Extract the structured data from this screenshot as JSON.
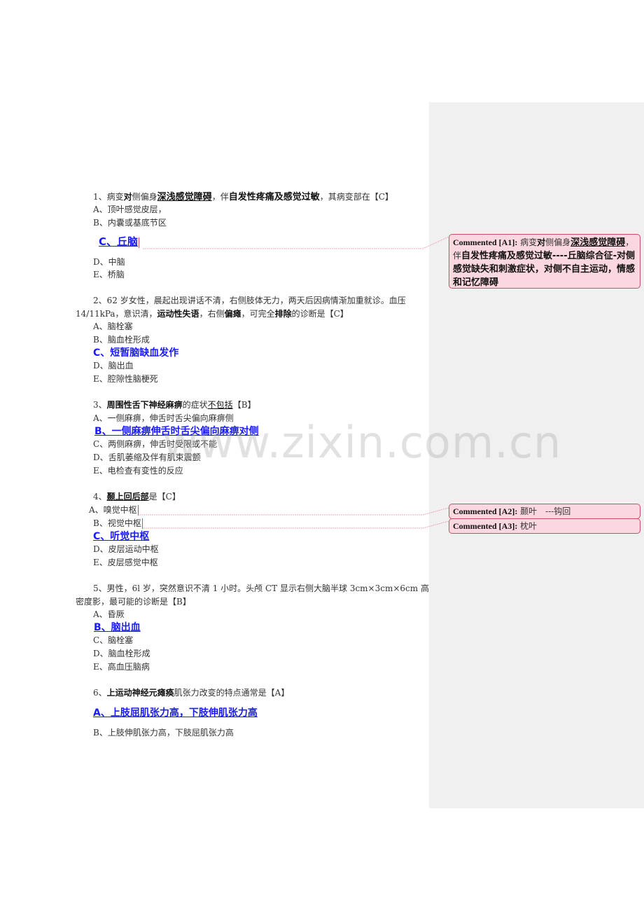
{
  "watermark": "www.zixin.com.cn",
  "questions": [
    {
      "stem_parts": [
        {
          "t": "1、病变",
          "s": "n"
        },
        {
          "t": "对",
          "s": "b"
        },
        {
          "t": "侧偏身",
          "s": "n"
        },
        {
          "t": "深浅感觉障碍",
          "s": "bu"
        },
        {
          "t": "，伴",
          "s": "n"
        },
        {
          "t": "自发性疼痛及感觉过敏",
          "s": "b"
        },
        {
          "t": "，其病变部在【C】",
          "s": "n"
        }
      ],
      "options": [
        "A、顶叶感觉皮层，",
        "B、内囊或基底节区",
        "C、丘脑",
        "D、中脑",
        "E、桥脑"
      ],
      "answer": "C"
    },
    {
      "stem_line1": "2、62 岁女性，晨起出现讲话不清，右侧肢体无力，两天后因病情渐加重就诊。血压",
      "stem_parts2": [
        {
          "t": "14/11kPa，意识清，",
          "s": "n"
        },
        {
          "t": "运动性失语",
          "s": "b"
        },
        {
          "t": "，右侧",
          "s": "n"
        },
        {
          "t": "偏瘫",
          "s": "b"
        },
        {
          "t": "，可完全",
          "s": "n"
        },
        {
          "t": "排除",
          "s": "b"
        },
        {
          "t": "的诊断是【C】",
          "s": "n"
        }
      ],
      "options": [
        "A、脑栓塞",
        "B、脑血栓形成",
        "C、短暂脑缺血发作",
        "D、脑出血",
        "E、腔隙性脑梗死"
      ],
      "answer": "C"
    },
    {
      "stem_parts": [
        {
          "t": "3、",
          "s": "n"
        },
        {
          "t": "周围性舌下神经麻痹",
          "s": "b"
        },
        {
          "t": "的症状",
          "s": "n"
        },
        {
          "t": "不包括",
          "s": "u"
        },
        {
          "t": "【B】",
          "s": "n"
        }
      ],
      "options": [
        "A、一侧麻痹，伸舌时舌尖偏向麻痹侧",
        "B、一侧麻痹伸舌时舌尖偏向麻痹对侧",
        "C、两侧麻痹，伸舌时受限或不能",
        "D、舌肌萎缩及伴有肌束震颤",
        "E、电检查有变性的反应"
      ],
      "answer": "B"
    },
    {
      "stem_parts": [
        {
          "t": "4、",
          "s": "n"
        },
        {
          "t": "颞上回后部",
          "s": "bu"
        },
        {
          "t": "是【C】",
          "s": "n"
        }
      ],
      "options": [
        "A、嗅觉中枢",
        "B、视觉中枢",
        "C、听觉中枢",
        "D、皮层运动中枢",
        "E、皮层感觉中枢"
      ],
      "answer": "C"
    },
    {
      "stem_line1": "5、男性，6l 岁，突然意识不清 1 小时。头颅 CT 显示右侧大脑半球 3cm×3cm×6cm 高",
      "stem_line2": "密度影，最可能的诊断是【B】",
      "options": [
        "A、昏厥",
        "B、脑出血",
        "C、脑栓塞",
        "D、脑血栓形成",
        "E、高血压脑病"
      ],
      "answer": "B"
    },
    {
      "stem_parts": [
        {
          "t": "6、",
          "s": "n"
        },
        {
          "t": "上运动神经元瘫痪",
          "s": "b"
        },
        {
          "t": "肌张力改变的特点通常是【A】",
          "s": "n"
        }
      ],
      "options": [
        "A、上肢屈肌张力高，下肢伸肌张力高",
        "B、上肢伸肌张力高，下肢屈肌张力高"
      ],
      "answer": "A"
    }
  ],
  "comments": [
    {
      "tag": "Commented [A1]:",
      "parts": [
        {
          "t": "病变",
          "s": "n"
        },
        {
          "t": "对",
          "s": "b"
        },
        {
          "t": "侧偏身",
          "s": "n"
        },
        {
          "t": "深浅感觉障碍",
          "s": "bu"
        },
        {
          "t": "，",
          "s": "n"
        },
        {
          "t": "伴",
          "s": "n"
        },
        {
          "t": "自发性疼痛及感觉过敏----丘脑综合征-对侧感觉缺失和刺激症状，对侧不自主运动，情感和记忆障碍",
          "s": "b"
        }
      ]
    },
    {
      "tag": "Commented [A2]:",
      "text": "颞叶　---钩回"
    },
    {
      "tag": "Commented [A3]:",
      "text": "枕叶"
    }
  ]
}
